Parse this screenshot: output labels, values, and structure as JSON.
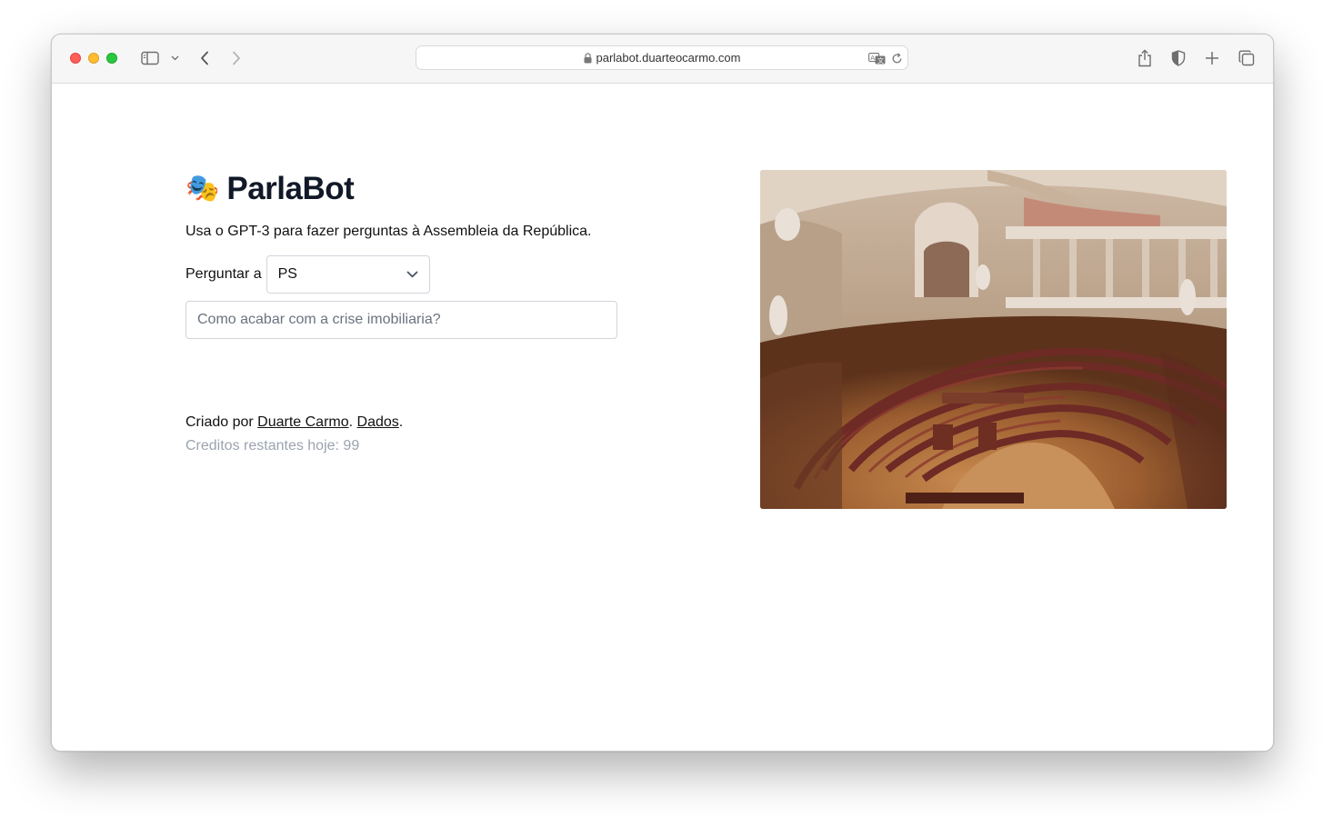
{
  "browser": {
    "url": "parlabot.duarteocarmo.com",
    "icons": [
      "sidebar-icon",
      "chevron-down-icon",
      "back-icon",
      "forward-icon",
      "lock-icon",
      "translate-icon",
      "reload-icon",
      "share-icon",
      "privacy-shield-icon",
      "new-tab-icon",
      "tabs-overview-icon"
    ]
  },
  "page": {
    "emoji": "🎭",
    "title": "ParlaBot",
    "subtitle": "Usa o GPT-3 para fazer perguntas à Assembleia da República.",
    "ask_label": "Perguntar a",
    "party_selected": "PS",
    "question_placeholder": "Como acabar com a crise imobiliaria?",
    "footer_prefix": "Criado por ",
    "author_link": "Duarte Carmo",
    "footer_sep": ". ",
    "data_link": "Dados",
    "footer_end": ".",
    "credits": "Creditos restantes hoje: 99"
  }
}
